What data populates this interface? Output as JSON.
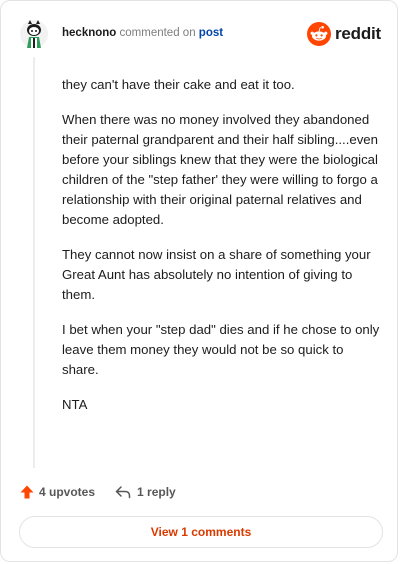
{
  "header": {
    "username": "hecknono",
    "action_text": "commented on",
    "post_link": "post",
    "brand": "reddit",
    "avatar_icon": "snoo-avatar-icon",
    "brand_icon": "reddit-snoo-icon",
    "brand_color": "#ff4500"
  },
  "comment": {
    "paragraphs": [
      "they can't have their cake and eat it too.",
      "When there was no money involved they abandoned their paternal grandparent and their half sibling....even before your siblings knew that they were the biological children of the \"step father' they were willing to forgo a relationship with their original paternal relatives and become adopted.",
      "They cannot now insist on a share of something your Great Aunt has absolutely no intention of giving to them.",
      "I bet when your \"step dad\" dies and if he chose to only leave them money they would not be so quick to share.",
      "NTA"
    ]
  },
  "actions": {
    "upvotes": "4 upvotes",
    "replies": "1 reply",
    "upvote_icon": "upvote-arrow-icon",
    "reply_icon": "reply-arrow-icon",
    "upvote_color": "#ff4500"
  },
  "footer": {
    "view_comments": "View 1 comments",
    "accent_color": "#d93a00"
  }
}
